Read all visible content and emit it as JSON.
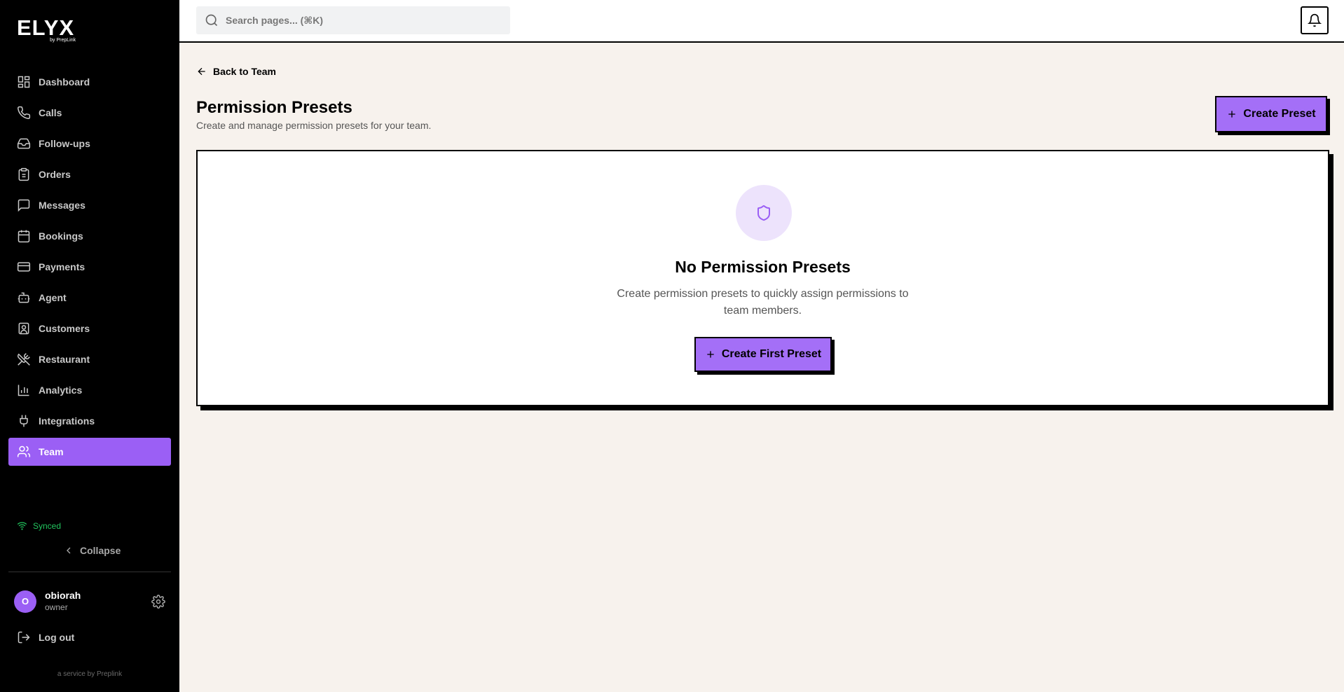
{
  "brand": {
    "logo": "ELYX",
    "logo_sub": "by PrepLink",
    "service": "a service by Preplink"
  },
  "sidebar": {
    "items": [
      {
        "label": "Dashboard",
        "icon": "dashboard-icon"
      },
      {
        "label": "Calls",
        "icon": "phone-icon"
      },
      {
        "label": "Follow-ups",
        "icon": "inbox-icon"
      },
      {
        "label": "Orders",
        "icon": "clipboard-icon"
      },
      {
        "label": "Messages",
        "icon": "message-icon"
      },
      {
        "label": "Bookings",
        "icon": "calendar-icon"
      },
      {
        "label": "Payments",
        "icon": "credit-card-icon"
      },
      {
        "label": "Agent",
        "icon": "bot-icon"
      },
      {
        "label": "Customers",
        "icon": "contact-icon"
      },
      {
        "label": "Restaurant",
        "icon": "utensils-icon"
      },
      {
        "label": "Analytics",
        "icon": "bar-chart-icon"
      },
      {
        "label": "Integrations",
        "icon": "plug-icon"
      },
      {
        "label": "Team",
        "icon": "users-icon",
        "active": true
      }
    ],
    "synced": "Synced",
    "collapse": "Collapse",
    "user": {
      "initial": "O",
      "name": "obiorah",
      "role": "owner"
    },
    "logout": "Log out"
  },
  "topbar": {
    "search_placeholder": "Search pages... (⌘K)"
  },
  "main": {
    "back": "Back to Team",
    "title": "Permission Presets",
    "subtitle": "Create and manage permission presets for your team.",
    "create_button": "Create Preset",
    "empty": {
      "title": "No Permission Presets",
      "description": "Create permission presets to quickly assign permissions to team members.",
      "button": "Create First Preset"
    }
  },
  "colors": {
    "accent": "#9b5ff5",
    "button": "#a46ff7",
    "background": "#f7f2ed",
    "synced": "#22c55e"
  }
}
